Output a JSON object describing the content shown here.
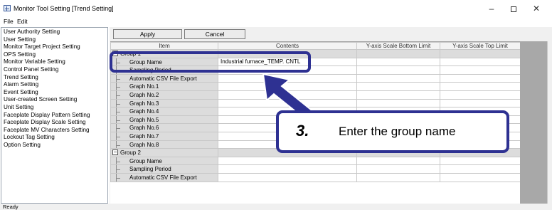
{
  "window": {
    "title": "Monitor Tool Setting [Trend Setting]"
  },
  "menu": [
    "File",
    "Edit"
  ],
  "settings_list": [
    "User Authority Setting",
    "User Setting",
    "Monitor Target Project Setting",
    "OPS Setting",
    "Monitor Variable Setting",
    "Control Panel Setting",
    "Trend Setting",
    "Alarm Setting",
    "Event Setting",
    "User-created Screen Setting",
    "Unit Setting",
    "Faceplate Display Pattern Setting",
    "Faceplate Display Scale Setting",
    "Faceplate MV Characters Setting",
    "Lockout Tag Setting",
    "Option Setting"
  ],
  "toolbar": {
    "apply_label": "Apply",
    "cancel_label": "Cancel"
  },
  "grid": {
    "headers": [
      "Item",
      "Contents",
      "Y-axis Scale Bottom Limit",
      "Y-axis Scale Top Limit"
    ],
    "rows": [
      {
        "kind": "group",
        "label": "Group 1",
        "expander": "−"
      },
      {
        "kind": "item",
        "label": "Group Name",
        "contents": "Industrial furnace_TEMP. CNTL"
      },
      {
        "kind": "item",
        "label": "Sampling Period",
        "contents": ""
      },
      {
        "kind": "item",
        "label": "Automatic CSV File Export",
        "contents": ""
      },
      {
        "kind": "item",
        "label": "Graph No.1",
        "contents": ""
      },
      {
        "kind": "item",
        "label": "Graph No.2",
        "contents": ""
      },
      {
        "kind": "item",
        "label": "Graph No.3",
        "contents": ""
      },
      {
        "kind": "item",
        "label": "Graph No.4",
        "contents": ""
      },
      {
        "kind": "item",
        "label": "Graph No.5",
        "contents": ""
      },
      {
        "kind": "item",
        "label": "Graph No.6",
        "contents": ""
      },
      {
        "kind": "item",
        "label": "Graph No.7",
        "contents": ""
      },
      {
        "kind": "item",
        "label": "Graph No.8",
        "contents": ""
      },
      {
        "kind": "group",
        "label": "Group 2",
        "expander": "−"
      },
      {
        "kind": "item",
        "label": "Group Name",
        "contents": ""
      },
      {
        "kind": "item",
        "label": "Sampling Period",
        "contents": ""
      },
      {
        "kind": "item",
        "label": "Automatic CSV File Export",
        "contents": ""
      }
    ]
  },
  "status_bar": {
    "text": "Ready"
  },
  "annotation": {
    "step_number": "3.",
    "step_text": "Enter the group name",
    "color": "#2e3192"
  }
}
